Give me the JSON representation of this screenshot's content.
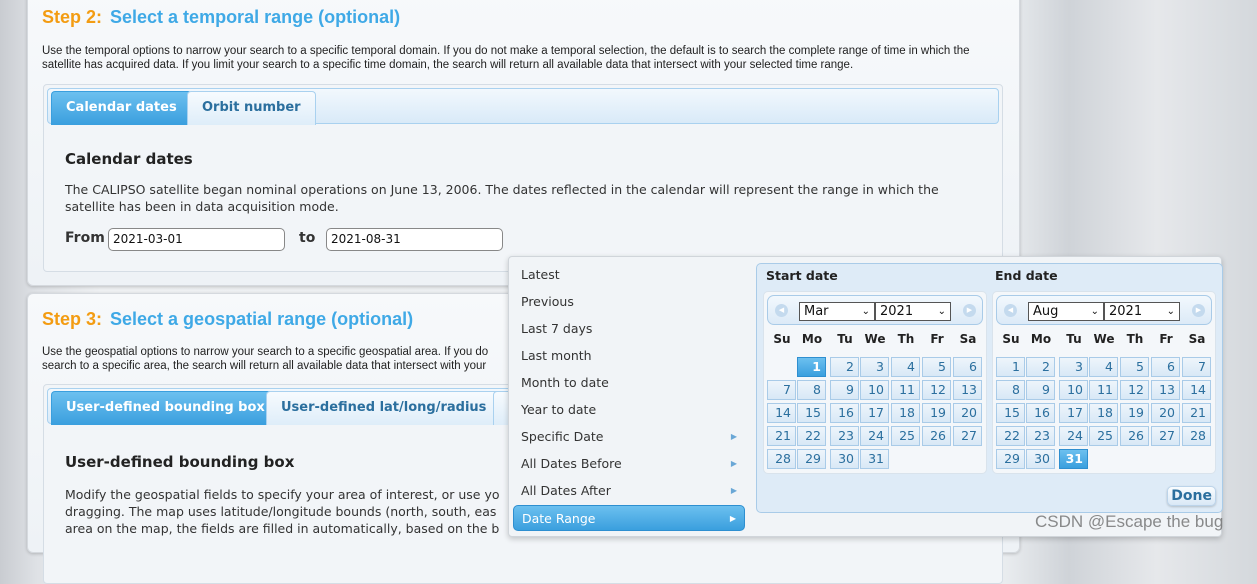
{
  "step2": {
    "num": "Step 2:",
    "title": "Select a temporal range (optional)",
    "intro": "Use the temporal options to narrow your search to a specific temporal domain. If you do not make a temporal selection, the default is to search the complete range of time in which the satellite has acquired data. If you limit your search to a specific time domain, the search will return all available data that intersect with your selected time range.",
    "tabs": [
      "Calendar dates",
      "Orbit number"
    ],
    "heading": "Calendar dates",
    "body": "The CALIPSO satellite began nominal operations on June 13, 2006. The dates reflected in the calendar will represent the range in which the satellite has been in data acquisition mode.",
    "from_label": "From",
    "from_value": "2021-03-01",
    "to_label": "to",
    "to_value": "2021-08-31"
  },
  "step3": {
    "num": "Step 3:",
    "title": "Select a geospatial range (optional)",
    "intro": "Use the geospatial options to narrow your search to a specific geospatial area. If you do",
    "intro2": "search to a specific area, the search will return all available data that intersect with your",
    "tabs": [
      "User-defined bounding box",
      "User-defined lat/long/radius"
    ],
    "heading": "User-defined bounding box",
    "body1": "Modify the geospatial fields to specify your area of interest, or use yo",
    "body2": "dragging. The map uses latitude/longitude bounds (north, south, eas",
    "body3": "area on the map, the fields are filled in automatically, based on the b"
  },
  "menu": {
    "items": [
      {
        "label": "Latest",
        "submenu": false
      },
      {
        "label": "Previous",
        "submenu": false
      },
      {
        "label": "Last 7 days",
        "submenu": false
      },
      {
        "label": "Last month",
        "submenu": false
      },
      {
        "label": "Month to date",
        "submenu": false
      },
      {
        "label": "Year to date",
        "submenu": false
      },
      {
        "label": "Specific Date",
        "submenu": true
      },
      {
        "label": "All Dates Before",
        "submenu": true
      },
      {
        "label": "All Dates After",
        "submenu": true
      },
      {
        "label": "Date Range",
        "submenu": true,
        "selected": true
      }
    ]
  },
  "calendars": [
    {
      "heading": "Start date",
      "month": "Mar",
      "month_index": 2,
      "year": "2021",
      "selected_day": 1
    },
    {
      "heading": "End date",
      "month": "Aug",
      "month_index": 7,
      "year": "2021",
      "selected_day": 31
    }
  ],
  "weekdays": [
    "Su",
    "Mo",
    "Tu",
    "We",
    "Th",
    "Fr",
    "Sa"
  ],
  "done_label": "Done",
  "watermark": "CSDN @Escape the bug",
  "colors": {
    "accent": "#3fa9e6",
    "step_number": "#f39c12"
  }
}
